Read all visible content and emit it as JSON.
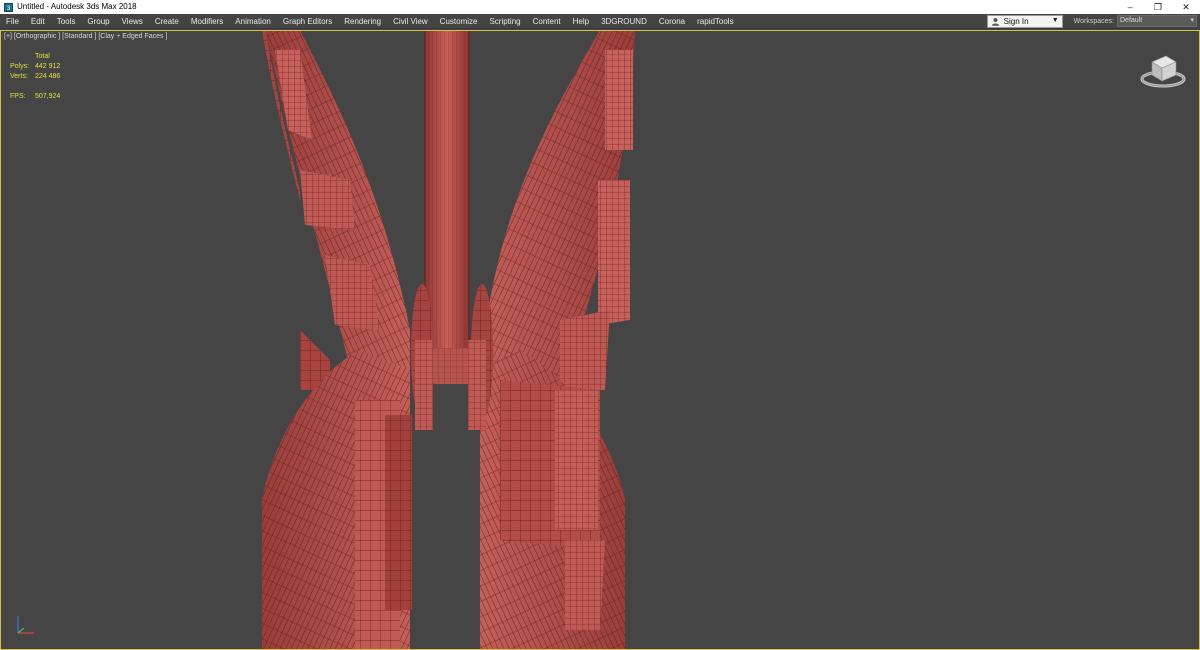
{
  "window": {
    "title": "Untitled - Autodesk 3ds Max 2018",
    "controls": [
      "–",
      "❐",
      "✕"
    ]
  },
  "menu": {
    "items": [
      "File",
      "Edit",
      "Tools",
      "Group",
      "Views",
      "Create",
      "Modifiers",
      "Animation",
      "Graph Editors",
      "Rendering",
      "Civil View",
      "Customize",
      "Scripting",
      "Content",
      "Help",
      "3DGROUND",
      "Corona",
      "rapidTools"
    ],
    "signin_label": "Sign In",
    "workspaces_label": "Workspaces:",
    "workspace_value": "Default"
  },
  "viewport": {
    "label": "[+] [Orthographic ] [Standard ] [Clay + Edged Faces ]",
    "stats": {
      "header": "Total",
      "polys_label": "Polys:",
      "polys_value": "442 912",
      "verts_label": "Verts:",
      "verts_value": "224 486",
      "fps_label": "FPS:",
      "fps_value": "507,924"
    }
  },
  "colors": {
    "clay": "#b85450",
    "clay_dark": "#8c3431",
    "wire": "#5a1a18",
    "viewport_bg": "#454545",
    "border_active": "#d3c24a",
    "stats_text": "#e2e23a"
  },
  "icons": {
    "app": "3ds-max-icon",
    "user": "user-icon",
    "viewcube": "viewcube-icon",
    "axis": "axis-tripod-icon"
  }
}
